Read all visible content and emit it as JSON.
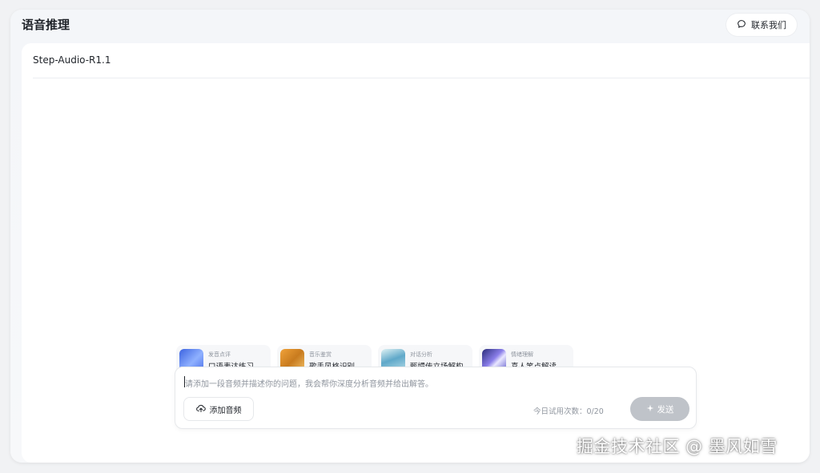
{
  "header": {
    "title": "语音推理",
    "contact_label": "联系我们"
  },
  "main": {
    "model_name": "Step-Audio-R1.1",
    "suggestions": [
      {
        "category": "发音点评",
        "title": "口语表达练习"
      },
      {
        "category": "音乐鉴赏",
        "title": "歌手风格识别"
      },
      {
        "category": "对话分析",
        "title": "甄嬛传立场解构"
      },
      {
        "category": "情绪理解",
        "title": "喜人笑点解读"
      }
    ]
  },
  "composer": {
    "placeholder": "请添加一段音频并描述你的问题，我会帮你深度分析音频并给出解答。",
    "add_audio_label": "添加音频",
    "quota_text": "今日试用次数：0/20",
    "send_label": "发送"
  },
  "watermark": "掘金技术社区 @ 墨风如雪",
  "icons": {
    "contact": "chat-bubble-icon",
    "add_audio": "cloud-upload-icon",
    "send": "sparkle-icon"
  }
}
